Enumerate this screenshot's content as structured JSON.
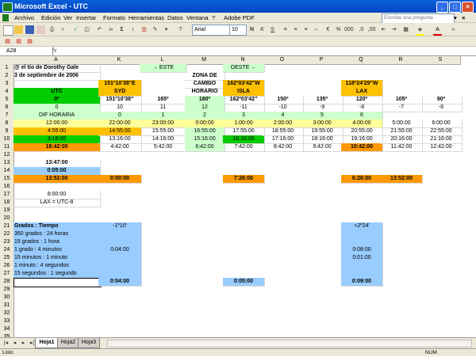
{
  "window": {
    "title": "Microsoft Excel - UTC"
  },
  "menu": [
    "Archivo",
    "Edición",
    "Ver",
    "Insertar",
    "Formato",
    "Herramientas",
    "Datos",
    "Ventana",
    "?",
    "Adobe PDF"
  ],
  "ask": {
    "placeholder": "Escriba una pregunta"
  },
  "toolbar": {
    "font": "Arial",
    "size": "10",
    "percent": "%"
  },
  "formula": {
    "cell": "A28",
    "fx": "fx"
  },
  "columns": [
    "A",
    "K",
    "L",
    "M",
    "N",
    "O",
    "P",
    "Q",
    "R",
    "S"
  ],
  "rows": [
    "1",
    "2",
    "3",
    "4",
    "5",
    "6",
    "7",
    "8",
    "9",
    "10",
    "11",
    "12",
    "13",
    "14",
    "15",
    "16",
    "17",
    "18",
    "19",
    "20",
    "21",
    "22",
    "23",
    "24",
    "25",
    "26",
    "27",
    "28",
    "29",
    "30",
    "31",
    "32",
    "33",
    "34",
    "35"
  ],
  "cells": {
    "a1": "@ el tío de Dorothy Gale",
    "a2": "3 de septiembre de 2006",
    "a4": "UTC",
    "a5": "0º",
    "a6": "0",
    "a7": "DIF HORARIA",
    "a8": "12:00:00",
    "a9": "4:55:00",
    "a10": "3:16:00",
    "a11": "18:42:00",
    "a13": "13:47:00",
    "a14": "0:05:00",
    "a15": "13:52:00",
    "a17": "8:00:00",
    "a18": "LAX = UTC-8",
    "a21": "Grados : Tiempo",
    "a22": "360 grados : 24 horas",
    "a23": "15 grados : 1 hora",
    "a24": "1 grado : 4 minutos",
    "a25": "15 minutos : 1 minuto",
    "a26": "1 minuto : 4 segundos",
    "a27": "15 segundos : 1 segundo",
    "k3": "151º10'38\"E",
    "k4": "SYD",
    "k5": "151º10'38\"",
    "k6": "10",
    "k7": "0",
    "k8": "22:00:00",
    "k9": "14:55:00",
    "k10": "13:16:00",
    "k11": "4:42:00",
    "k15": "0:00:00",
    "k21": "-1º10'",
    "k24": "0:04:00",
    "k28": "0:04:00",
    "l1": "→ ESTE",
    "l5": "165º",
    "l6": "11",
    "l7": "1",
    "l8": "23:00:00",
    "l9": "15:55:00",
    "l10": "14:16:00",
    "l11": "5:42:00",
    "m2": "ZONA DE",
    "m3": "CAMBIO",
    "m4": "HORARIO",
    "m5": "180º",
    "m6": "12",
    "m7": "2",
    "m8": "0:00:00",
    "m9": "16:55:00",
    "m10": "15:16:00",
    "m11": "6:42:00",
    "n1": "OESTE ←",
    "n3": "162º03'42\"W",
    "n4": "ISLA",
    "n5": "162º03'42\"",
    "n6": "-11",
    "n7": "3",
    "n8": "1:00:00",
    "n9": "17:55:00",
    "n10": "16:16:00",
    "n11": "7:42:00",
    "n15": "7:26:00",
    "n28": "0:05:00",
    "o5": "150º",
    "o6": "-10",
    "o7": "4",
    "o8": "2:00:00",
    "o9": "18:55:00",
    "o10": "17:16:00",
    "o11": "8:42:00",
    "p5": "135º",
    "p6": "-9",
    "p7": "5",
    "p8": "3:00:00",
    "p9": "19:55:00",
    "p10": "18:16:00",
    "p11": "9:42:00",
    "q3": "118º24'29\"W",
    "q4": "LAX",
    "q5": "120º",
    "q6": "-8",
    "q7": "6",
    "q8": "4:00:00",
    "q9": "20:55:00",
    "q10": "19:16:00",
    "q11": "10:42:00",
    "q15": "6:26:00",
    "q21": "+2º24'",
    "q24": "0:08:00",
    "q25": "0:01:00",
    "q28": "0:09:00",
    "r5": "105º",
    "r6": "-7",
    "r8": "5:00:00",
    "r9": "21:55:00",
    "r10": "20:16:00",
    "r11": "11:42:00",
    "r15": "13:52:00",
    "s5": "90º",
    "s6": "-6",
    "s8": "6:00:00",
    "s9": "22:55:00",
    "s10": "21:16:00",
    "s11": "12:42:00"
  },
  "tabs": [
    "Hoja1",
    "Hoja2",
    "Hoja3"
  ],
  "status": {
    "left": "Listo",
    "right": "NUM"
  }
}
